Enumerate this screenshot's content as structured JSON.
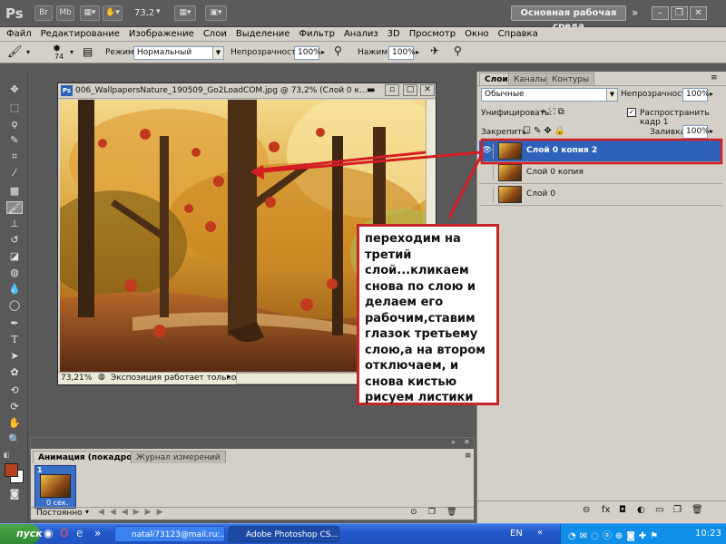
{
  "app": {
    "logo": "Ps",
    "top_buttons": [
      "Br",
      "Mb"
    ],
    "zoom": "73,2",
    "workspace": "Основная рабочая среда"
  },
  "menu": [
    "Файл",
    "Редактирование",
    "Изображение",
    "Слои",
    "Выделение",
    "Фильтр",
    "Анализ",
    "3D",
    "Просмотр",
    "Окно",
    "Справка"
  ],
  "options": {
    "brush_size": "74",
    "mode_label": "Режим:",
    "mode_value": "Нормальный",
    "opacity_label": "Непрозрачность:",
    "opacity_value": "100%",
    "pressure_label": "Нажим:",
    "pressure_value": "100%"
  },
  "document": {
    "title": "006_WallpapersNature_190509_Go2LoadCOM.jpg @ 73,2% (Слой 0 к...",
    "zoom": "73,21%",
    "status": "Экспозиция работает только в ..."
  },
  "layers_panel": {
    "tabs": [
      "Слои",
      "Каналы",
      "Контуры"
    ],
    "blend_mode": "Обычные",
    "opacity_label": "Непрозрачность:",
    "opacity_value": "100%",
    "unify_label": "Унифицировать:",
    "propagate_label": "Распространить кадр 1",
    "lock_label": "Закрепить:",
    "fill_label": "Заливка:",
    "fill_value": "100%",
    "layers": [
      {
        "name": "Слой 0 копия 2",
        "visible": true,
        "selected": true
      },
      {
        "name": "Слой 0 копия",
        "visible": false,
        "selected": false
      },
      {
        "name": "Слой 0",
        "visible": false,
        "selected": false
      }
    ]
  },
  "animation_panel": {
    "tabs": [
      "Анимация (покадровая)",
      "Журнал измерений"
    ],
    "frame_number": "1",
    "frame_delay": "0 сек.",
    "loop": "Постоянно"
  },
  "callout": {
    "text": "переходим на третий слой...кликаем снова по слою и делаем его рабочим,ставим глазок третьему слою,а на втором отключаем, и снова кистью рисуем листики"
  },
  "taskbar": {
    "start": "пуск",
    "tasks": [
      "natali73123@mail.ru:...",
      "Adobe Photoshop CS..."
    ],
    "lang": "EN",
    "time": "10:23"
  },
  "colors": {
    "foreground": "#b8401c",
    "background": "#ffffff",
    "accent": "#c8252a",
    "selection": "#2e62b8"
  }
}
